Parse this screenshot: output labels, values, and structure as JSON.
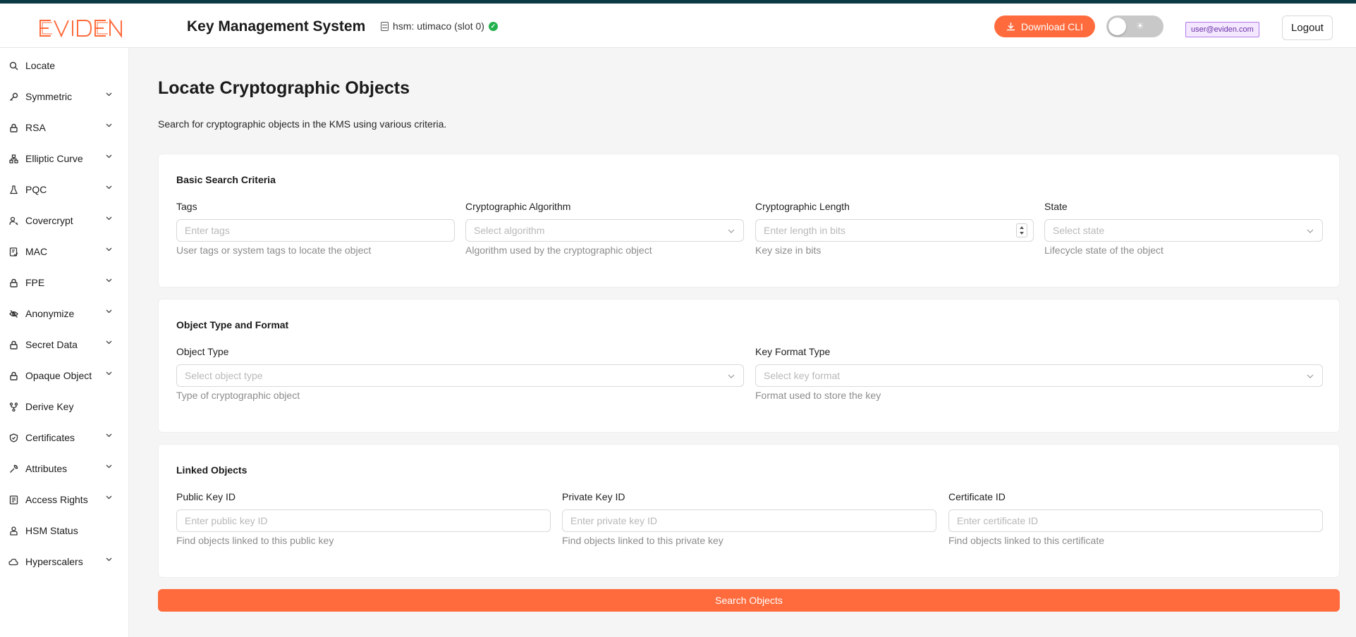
{
  "header": {
    "logo_text": "EVIDEN",
    "app_title": "Key Management System",
    "hsm_status": "hsm: utimaco (slot 0)",
    "download_label": "Download CLI",
    "theme_icon": "sun-icon",
    "user_email": "user@eviden.com",
    "logout_label": "Logout"
  },
  "colors": {
    "accent": "#ff6b3d",
    "top_strip": "#0c3a44",
    "status_ok": "#22b14c",
    "user_badge": "#b277e8"
  },
  "sidebar": {
    "items": [
      {
        "label": "Locate",
        "icon": "search-icon",
        "expandable": false
      },
      {
        "label": "Symmetric",
        "icon": "key-icon",
        "expandable": true
      },
      {
        "label": "RSA",
        "icon": "lock-icon",
        "expandable": true
      },
      {
        "label": "Elliptic Curve",
        "icon": "network-icon",
        "expandable": true
      },
      {
        "label": "PQC",
        "icon": "flask-icon",
        "expandable": true
      },
      {
        "label": "Covercrypt",
        "icon": "user-lock-icon",
        "expandable": true
      },
      {
        "label": "MAC",
        "icon": "file-check-icon",
        "expandable": true
      },
      {
        "label": "FPE",
        "icon": "lock-icon",
        "expandable": true
      },
      {
        "label": "Anonymize",
        "icon": "eye-off-icon",
        "expandable": true
      },
      {
        "label": "Secret Data",
        "icon": "lock-icon",
        "expandable": true
      },
      {
        "label": "Opaque Object",
        "icon": "lock-icon",
        "expandable": true
      },
      {
        "label": "Derive Key",
        "icon": "fork-icon",
        "expandable": false
      },
      {
        "label": "Certificates",
        "icon": "shield-icon",
        "expandable": true
      },
      {
        "label": "Attributes",
        "icon": "wrench-icon",
        "expandable": true
      },
      {
        "label": "Access Rights",
        "icon": "file-list-icon",
        "expandable": true
      },
      {
        "label": "HSM Status",
        "icon": "person-icon",
        "expandable": false
      },
      {
        "label": "Hyperscalers",
        "icon": "cloud-icon",
        "expandable": true
      }
    ]
  },
  "main": {
    "title": "Locate Cryptographic Objects",
    "description": "Search for cryptographic objects in the KMS using various criteria.",
    "basic": {
      "title": "Basic Search Criteria",
      "tags": {
        "label": "Tags",
        "placeholder": "Enter tags",
        "help": "User tags or system tags to locate the object"
      },
      "algorithm": {
        "label": "Cryptographic Algorithm",
        "placeholder": "Select algorithm",
        "help": "Algorithm used by the cryptographic object"
      },
      "length": {
        "label": "Cryptographic Length",
        "placeholder": "Enter length in bits",
        "help": "Key size in bits"
      },
      "state": {
        "label": "State",
        "placeholder": "Select state",
        "help": "Lifecycle state of the object"
      }
    },
    "type_format": {
      "title": "Object Type and Format",
      "object_type": {
        "label": "Object Type",
        "placeholder": "Select object type",
        "help": "Type of cryptographic object"
      },
      "key_format": {
        "label": "Key Format Type",
        "placeholder": "Select key format",
        "help": "Format used to store the key"
      }
    },
    "linked": {
      "title": "Linked Objects",
      "public_key": {
        "label": "Public Key ID",
        "placeholder": "Enter public key ID",
        "help": "Find objects linked to this public key"
      },
      "private_key": {
        "label": "Private Key ID",
        "placeholder": "Enter private key ID",
        "help": "Find objects linked to this private key"
      },
      "certificate": {
        "label": "Certificate ID",
        "placeholder": "Enter certificate ID",
        "help": "Find objects linked to this certificate"
      }
    },
    "search_button": "Search Objects"
  }
}
